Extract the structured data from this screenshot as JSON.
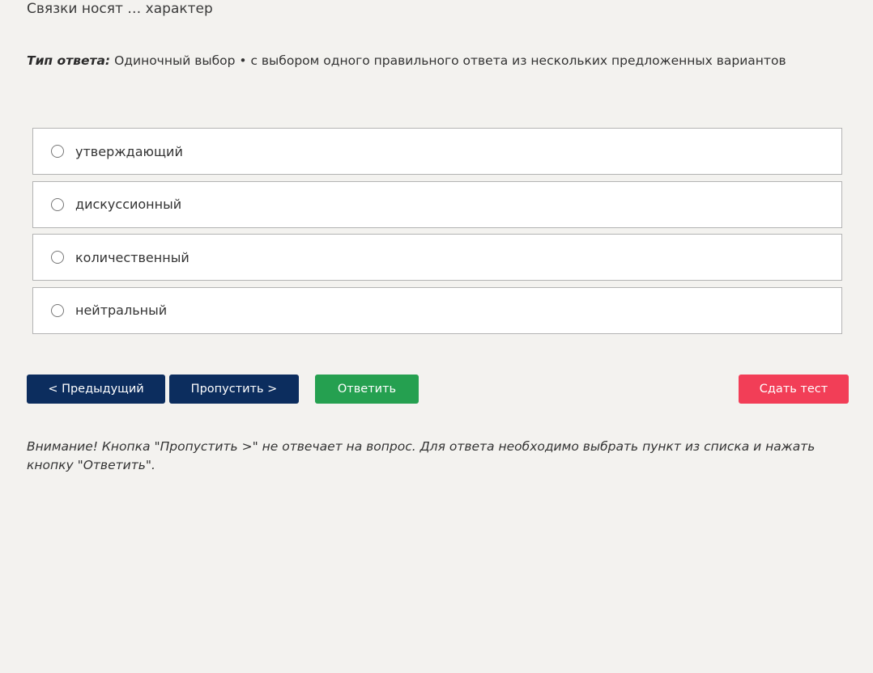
{
  "question": {
    "text": "Связки носят … характер"
  },
  "answer_type": {
    "label": "Тип ответа:",
    "value": "Одиночный выбор • с выбором одного правильного ответа из нескольких предложенных вариантов"
  },
  "options": [
    {
      "label": "утверждающий",
      "selected": false
    },
    {
      "label": "дискуссионный",
      "selected": false
    },
    {
      "label": "количественный",
      "selected": false
    },
    {
      "label": "нейтральный",
      "selected": false
    }
  ],
  "buttons": {
    "prev": "< Предыдущий",
    "skip": "Пропустить >",
    "answer": "Ответить",
    "finish": "Сдать тест"
  },
  "notice": {
    "text": "Внимание! Кнопка \"Пропустить >\" не отвечает на вопрос. Для ответа необходимо выбрать пункт из списка и нажать кнопку \"Ответить\"."
  },
  "colors": {
    "background": "#f3f2ef",
    "navy_button": "#0c2d5e",
    "answer_button": "#25a050",
    "finish_button": "#f23e57"
  }
}
